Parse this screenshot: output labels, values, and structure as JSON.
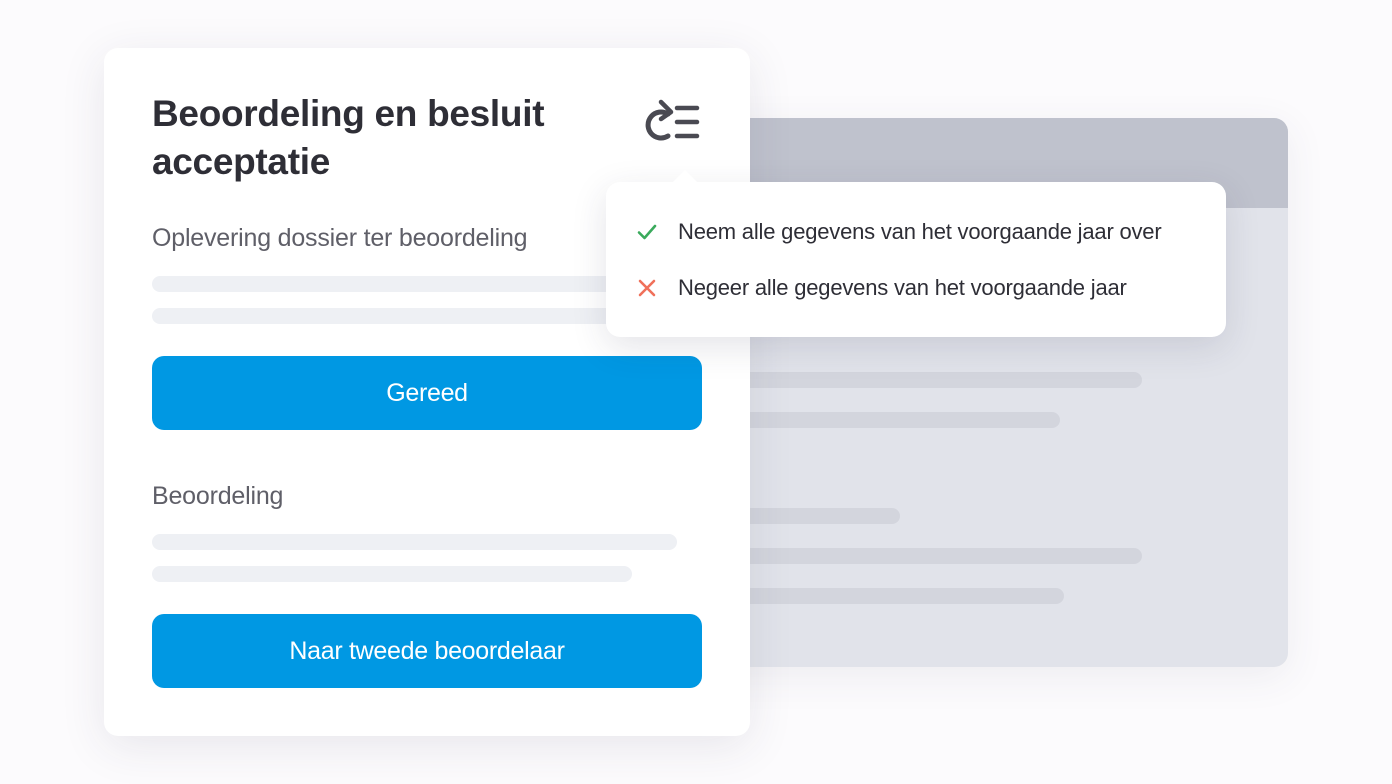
{
  "card": {
    "title": "Beoordeling en besluit acceptatie",
    "sync_icon": "sync-list-icon",
    "section1": {
      "label": "Oplevering dossier ter beoordeling",
      "button_label": "Gereed"
    },
    "section2": {
      "label": "Beoordeling",
      "button_label": "Naar tweede beoordelaar"
    }
  },
  "popover": {
    "options": [
      {
        "label": "Neem alle gegevens van het voorgaande jaar over",
        "icon": "check-icon",
        "icon_color": "#3aaa5c"
      },
      {
        "label": "Negeer alle gegevens van het voorgaande jaar",
        "icon": "close-icon",
        "icon_color": "#f0705a"
      }
    ]
  },
  "colors": {
    "primary_button": "#0098e3",
    "background_window": "#e1e3ea",
    "background_window_header": "#bfc2cd"
  }
}
